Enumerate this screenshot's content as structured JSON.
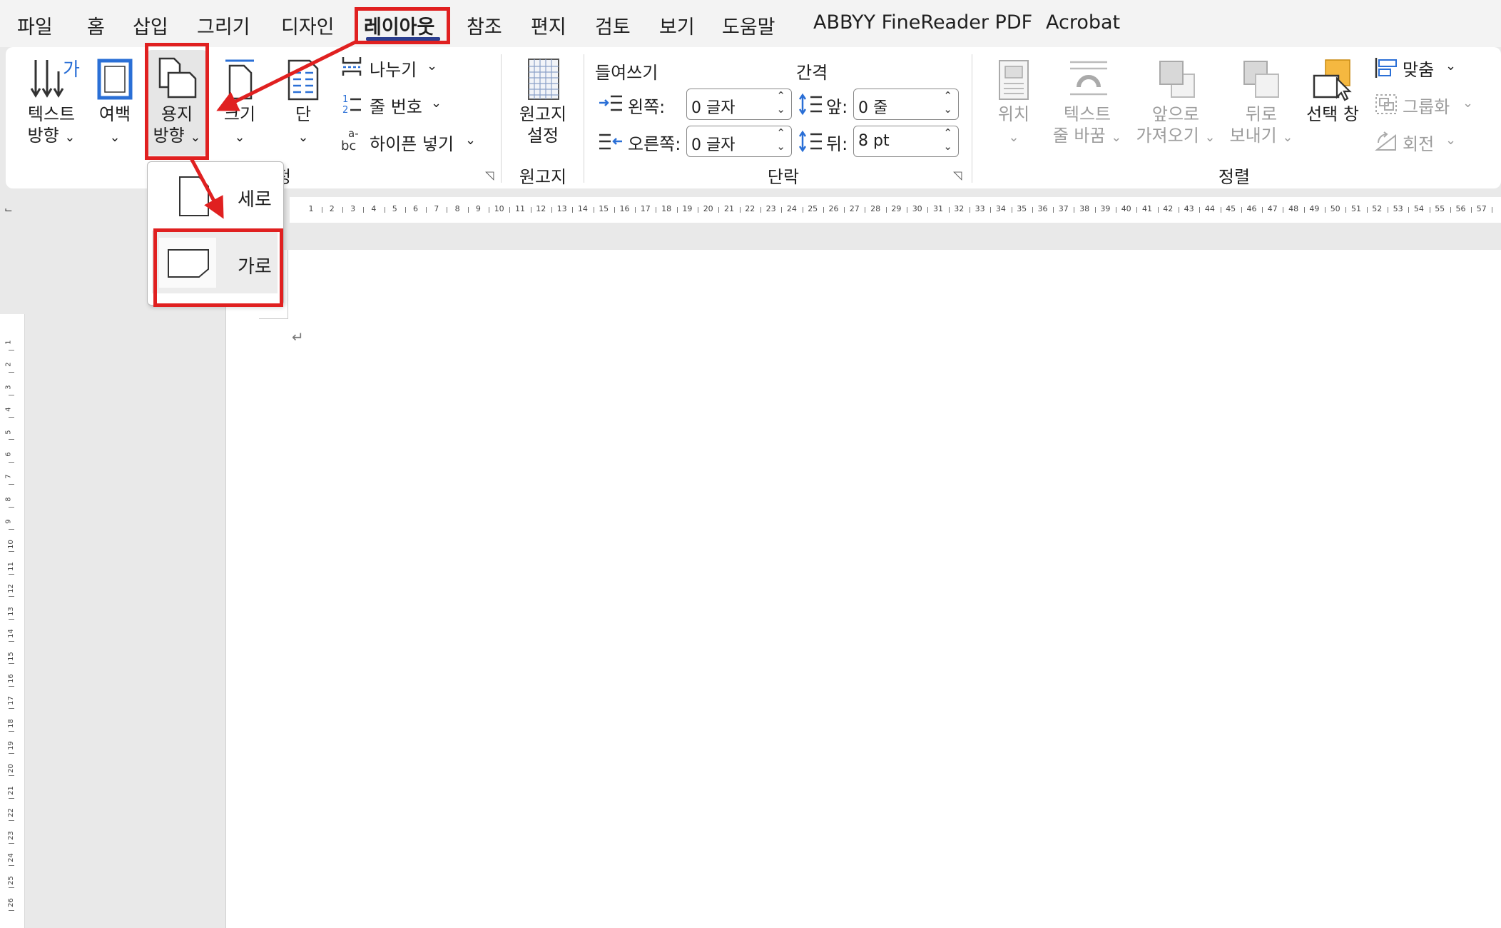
{
  "menu": {
    "tabs": [
      "파일",
      "홈",
      "삽입",
      "그리기",
      "디자인",
      "레이아웃",
      "참조",
      "편지",
      "검토",
      "보기",
      "도움말",
      "ABBYY FineReader PDF",
      "Acrobat"
    ],
    "active_tab": "레이아웃"
  },
  "ribbon": {
    "page_setup": {
      "text_direction_line1": "텍스트",
      "text_direction_line2": "방향",
      "text_direction_icon_glyph": "가",
      "margins": "여백",
      "orientation_line1": "용지",
      "orientation_line2": "방향",
      "size": "크기",
      "columns": "단",
      "breaks": "나누기",
      "line_numbers": "줄 번호",
      "hyphenation": "하이픈 넣기",
      "group_label_fragment": "정"
    },
    "manuscript": {
      "label_line1": "원고지",
      "label_line2": "설정",
      "group_label": "원고지"
    },
    "paragraph": {
      "indent_header": "들여쓰기",
      "spacing_header": "간격",
      "left_label": "왼쪽:",
      "left_value": "0 글자",
      "right_label": "오른쪽:",
      "right_value": "0 글자",
      "before_label": "앞:",
      "before_value": "0 줄",
      "after_label": "뒤:",
      "after_value": "8 pt",
      "group_label": "단락"
    },
    "arrange": {
      "position": "위치",
      "wrap_text_line1": "텍스트",
      "wrap_text_line2": "줄 바꿈",
      "bring_forward_line1": "앞으로",
      "bring_forward_line2": "가져오기",
      "send_backward_line1": "뒤로",
      "send_backward_line2": "보내기",
      "selection_pane": "선택 창",
      "align": "맞춤",
      "group": "그룹화",
      "rotate": "회전",
      "group_label": "정렬"
    }
  },
  "orientation_menu": {
    "portrait": "세로",
    "landscape": "가로"
  },
  "ruler": {
    "h_numbers": [
      "1",
      "2",
      "3",
      "4",
      "5",
      "6",
      "7",
      "8",
      "9",
      "10",
      "11",
      "12",
      "13",
      "14",
      "15",
      "16",
      "17",
      "18",
      "19",
      "20",
      "21",
      "22",
      "23",
      "24",
      "25",
      "26",
      "27",
      "28",
      "29",
      "30",
      "31",
      "32",
      "33",
      "34",
      "35",
      "36",
      "37",
      "38",
      "39",
      "40",
      "41",
      "42",
      "43",
      "44",
      "45",
      "46",
      "47",
      "48",
      "49",
      "50",
      "51",
      "52",
      "53",
      "54",
      "55",
      "56",
      "57"
    ],
    "v_numbers": [
      "1",
      "2",
      "3",
      "4",
      "5",
      "6",
      "7",
      "8",
      "9",
      "10",
      "11",
      "12",
      "13",
      "14",
      "15",
      "16",
      "17",
      "18",
      "19",
      "20",
      "21",
      "22",
      "23",
      "24",
      "25",
      "26"
    ]
  },
  "document": {
    "paragraph_mark": "↵"
  },
  "colors": {
    "highlight": "#e02020",
    "active_underline": "#2b3e8f",
    "accent_blue": "#2a6fd6",
    "selection_orange": "#f5b840"
  }
}
